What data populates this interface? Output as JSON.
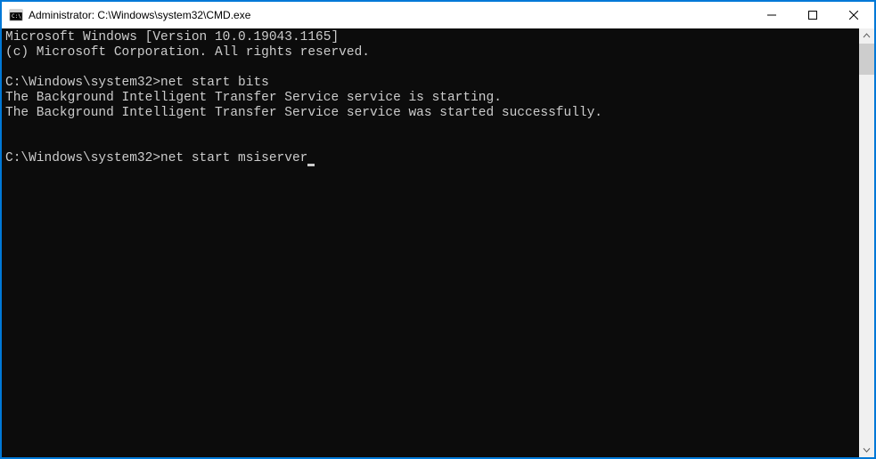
{
  "window": {
    "title": "Administrator: C:\\Windows\\system32\\CMD.exe"
  },
  "terminal": {
    "lines": [
      "Microsoft Windows [Version 10.0.19043.1165]",
      "(c) Microsoft Corporation. All rights reserved.",
      "",
      "C:\\Windows\\system32>net start bits",
      "The Background Intelligent Transfer Service service is starting.",
      "The Background Intelligent Transfer Service service was started successfully.",
      "",
      "",
      "C:\\Windows\\system32>net start msiserver"
    ],
    "current_prompt": "C:\\Windows\\system32>",
    "current_command": "net start msiserver"
  }
}
